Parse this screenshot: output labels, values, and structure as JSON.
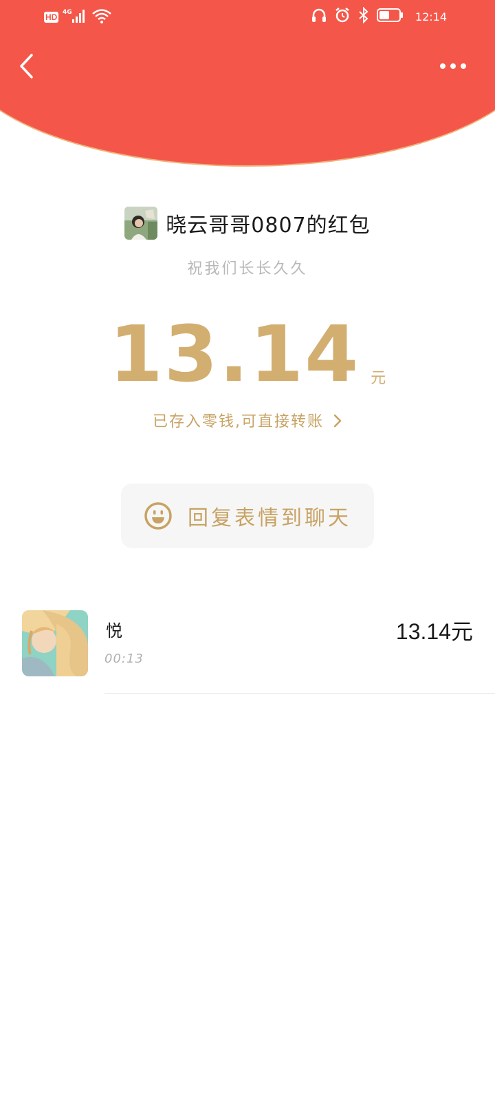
{
  "status_bar": {
    "hd_label": "HD",
    "network_label": "4G",
    "time": "12:14"
  },
  "sender": {
    "title": "晓云哥哥0807的红包",
    "blessing": "祝我们长长久久"
  },
  "amount": {
    "value": "13.14",
    "unit": "元"
  },
  "saved_link": "已存入零钱,可直接转账",
  "reply_button": "回复表情到聊天",
  "records": [
    {
      "name": "悦",
      "time": "00:13",
      "amount": "13.14元"
    }
  ],
  "colors": {
    "header_red": "#f4574a",
    "gold": "#d2ae70",
    "gold_text": "#c8a263"
  }
}
